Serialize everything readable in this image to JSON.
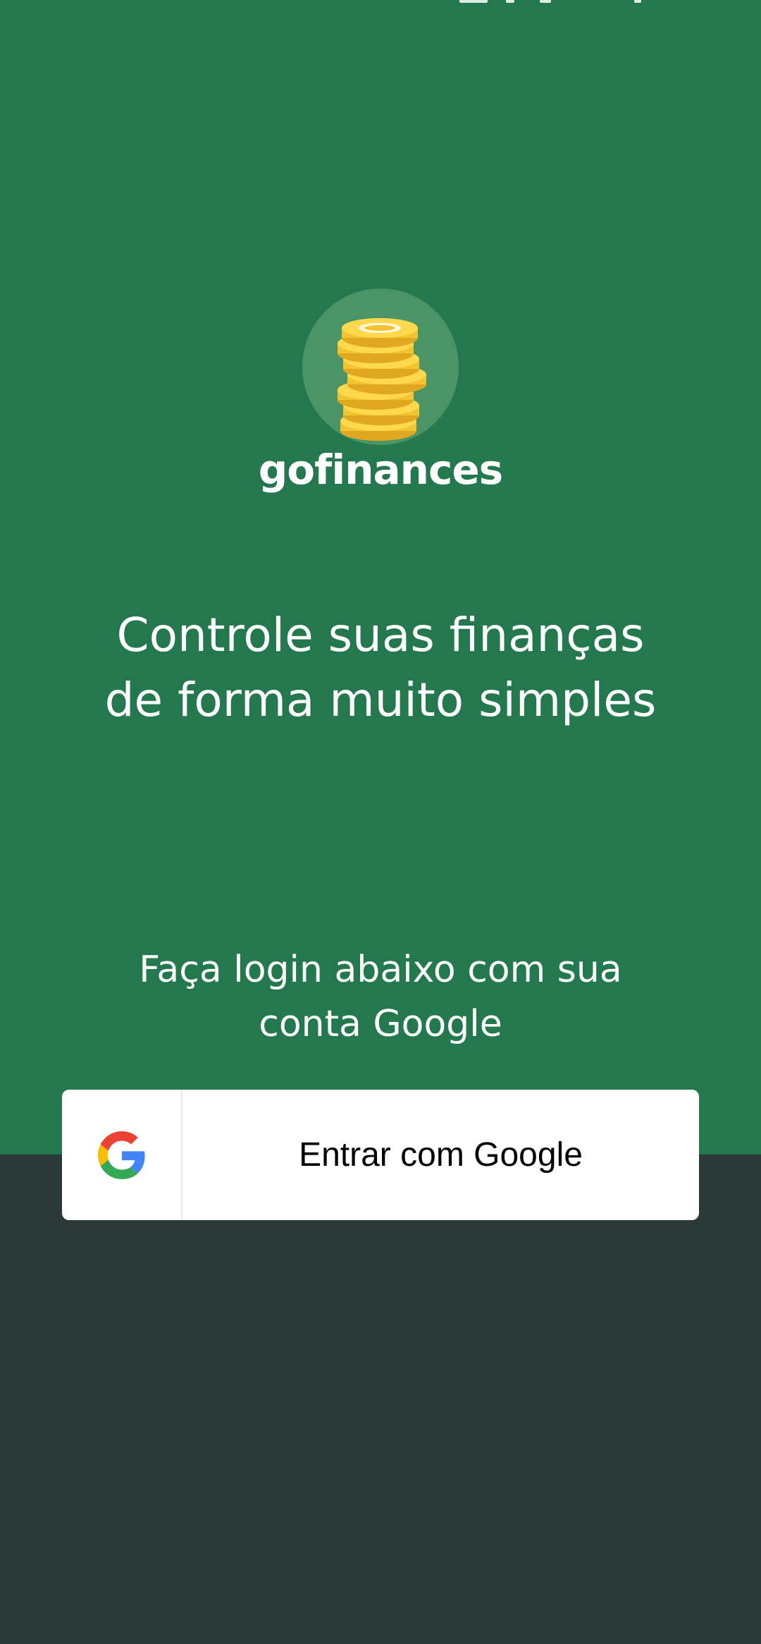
{
  "brand": {
    "name": "gofinances",
    "logo_icon": "coin-stack-icon"
  },
  "headline": "Controle suas finanças de forma muito simples",
  "subtitle": "Faça login abaixo com sua conta Google",
  "login": {
    "google_button_label": "Entrar com Google",
    "google_icon": "google-icon"
  },
  "colors": {
    "primary": "#23784d",
    "background": "#2c3a37",
    "logo_circle": "#4a9466",
    "coin": "#f4c430",
    "text_light": "#ffffff",
    "button_bg": "#ffffff"
  }
}
